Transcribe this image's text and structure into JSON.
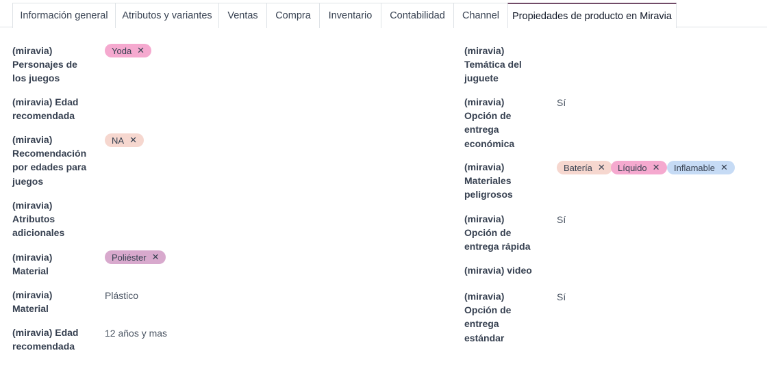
{
  "tabs": [
    {
      "label": "Información general"
    },
    {
      "label": "Atributos y variantes"
    },
    {
      "label": "Ventas"
    },
    {
      "label": "Compra"
    },
    {
      "label": "Inventario"
    },
    {
      "label": "Contabilidad"
    },
    {
      "label": "Channel"
    },
    {
      "label": "Propiedades de producto en Miravia"
    }
  ],
  "left": {
    "f1": {
      "l1": "(miravia)",
      "l2": "Personajes de",
      "l3": "los juegos",
      "tag": "Yoda"
    },
    "f2": {
      "l1": "(miravia) Edad",
      "l2": "recomendada"
    },
    "f3": {
      "l1": "(miravia)",
      "l2": "Recomendación",
      "l3": "por edades para",
      "l4": "juegos",
      "tag": "NA"
    },
    "f4": {
      "l1": "(miravia)",
      "l2": "Atributos",
      "l3": "adicionales"
    },
    "f5": {
      "l1": "(miravia)",
      "l2": "Material",
      "tag": "Poliéster"
    },
    "f6": {
      "l1": "(miravia)",
      "l2": "Material",
      "value": "Plástico"
    },
    "f7": {
      "l1": "(miravia) Edad",
      "l2": "recomendada",
      "value": "12 años y mas"
    }
  },
  "right": {
    "f1": {
      "l1": "(miravia)",
      "l2": "Temática del",
      "l3": "juguete"
    },
    "f2": {
      "l1": "(miravia)",
      "l2": "Opción de",
      "l3": "entrega",
      "l4": "económica",
      "value": "Sí"
    },
    "f3": {
      "l1": "(miravia)",
      "l2": "Materiales",
      "l3": "peligrosos",
      "tags": [
        "Batería",
        "Líquido",
        "Inflamable"
      ]
    },
    "f4": {
      "l1": "(miravia)",
      "l2": "Opción de",
      "l3": "entrega rápida",
      "value": "Sí"
    },
    "f5": {
      "l1": "(miravia) video"
    },
    "f6": {
      "l1": "(miravia)",
      "l2": "Opción de",
      "l3": "entrega",
      "l4": "estándar",
      "value": "Sí"
    }
  },
  "remove_glyph": "✕",
  "colors": {
    "tag_pink": "#f5a9cf",
    "tag_peach": "#f6d7cf",
    "tag_mauve": "#d8a9cd",
    "tag_blue": "#c6dbf5",
    "active_tab_accent": "#714B67"
  }
}
